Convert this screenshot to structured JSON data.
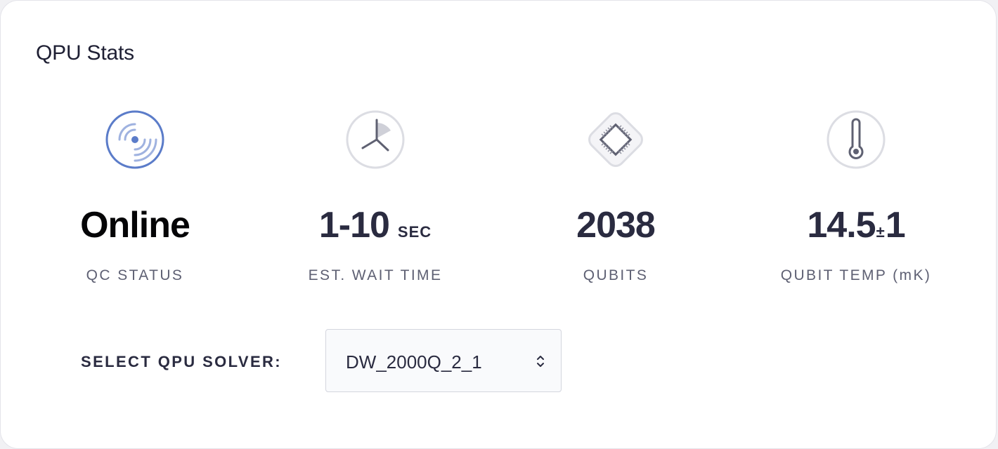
{
  "card": {
    "title": "QPU Stats"
  },
  "stats": [
    {
      "icon": "signal-icon",
      "value": "Online",
      "label": "QC STATUS"
    },
    {
      "icon": "clock-icon",
      "value": "1-10",
      "unit": "SEC",
      "label": "EST. WAIT TIME"
    },
    {
      "icon": "chip-icon",
      "value": "2038",
      "label": "QUBITS"
    },
    {
      "icon": "thermometer-icon",
      "value": "14.5",
      "plus_minus": "±",
      "tolerance": "1",
      "label": "QUBIT TEMP (mK)"
    }
  ],
  "solver": {
    "label": "SELECT QPU SOLVER:",
    "selected": "DW_2000Q_2_1"
  },
  "colors": {
    "accent_blue": "#5b7cc9",
    "icon_gray": "#5f6172",
    "icon_ring": "#dcdde3"
  }
}
